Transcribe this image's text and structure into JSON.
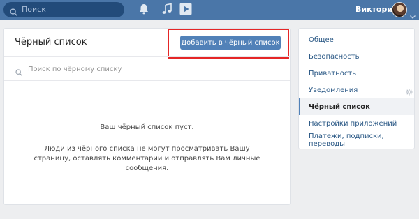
{
  "topbar": {
    "search_placeholder": "Поиск",
    "user_name": "Виктория",
    "icons": [
      "search-icon",
      "bell-icon",
      "music-icon",
      "video-icon",
      "chevron-down-icon"
    ],
    "bg_color": "#4a76a8"
  },
  "main": {
    "title": "Чёрный список",
    "add_button": "Добавить в чёрный список",
    "search_placeholder": "Поиск по чёрному списку",
    "empty_title": "Ваш чёрный список пуст.",
    "empty_description": "Люди из чёрного списка не могут просматривать Вашу страницу, оставлять комментарии и отправлять Вам личные сообщения.",
    "highlight_color": "#e52626"
  },
  "menu": {
    "items": [
      {
        "label": "Общее"
      },
      {
        "label": "Безопасность"
      },
      {
        "label": "Приватность"
      },
      {
        "label": "Уведомления"
      },
      {
        "label": "Чёрный список",
        "active": true
      },
      {
        "label": "Настройки приложений"
      },
      {
        "label": "Платежи, подписки, переводы"
      }
    ],
    "link_color": "#2a5885",
    "active_accent": "#5181b8"
  }
}
